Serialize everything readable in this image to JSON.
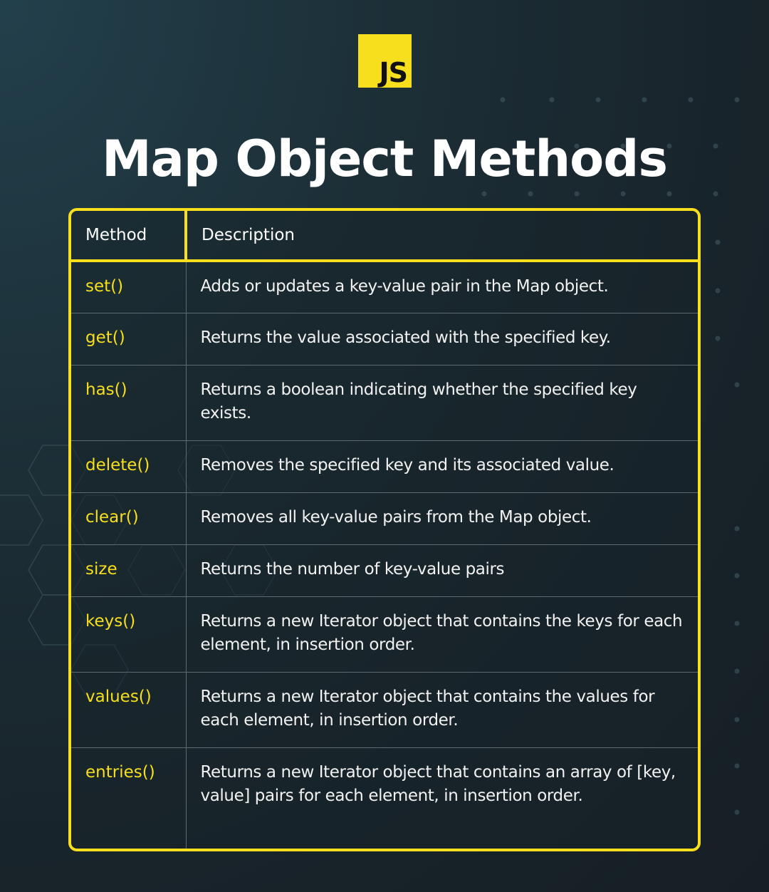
{
  "logo": {
    "text": "JS",
    "color": "#f7df1e",
    "icon": "js-logo-icon"
  },
  "title": "Map Object Methods",
  "colors": {
    "accent": "#f7df1e",
    "background": "#1b2a31",
    "text": "#ffffff",
    "divider": "#5d6b70"
  },
  "table": {
    "headers": {
      "method": "Method",
      "description": "Description"
    },
    "rows": [
      {
        "method": "set()",
        "description": "Adds or updates a key-value pair in the Map object."
      },
      {
        "method": "get()",
        "description": "Returns the value associated with the specified key."
      },
      {
        "method": "has()",
        "description": "Returns a boolean indicating whether the specified key exists."
      },
      {
        "method": "delete()",
        "description": "Removes the specified key and its associated value."
      },
      {
        "method": "clear()",
        "description": "Removes all key-value pairs from the Map object."
      },
      {
        "method": "size",
        "description": "Returns the number of key-value pairs"
      },
      {
        "method": "keys()",
        "description": "Returns a new Iterator object that contains the keys for each element, in insertion order."
      },
      {
        "method": "values()",
        "description": "Returns a new Iterator object that contains the values for each element, in insertion order."
      },
      {
        "method": "entries()",
        "description": "Returns a new Iterator object that contains an array of [key, value] pairs for each element, in insertion order."
      }
    ]
  }
}
